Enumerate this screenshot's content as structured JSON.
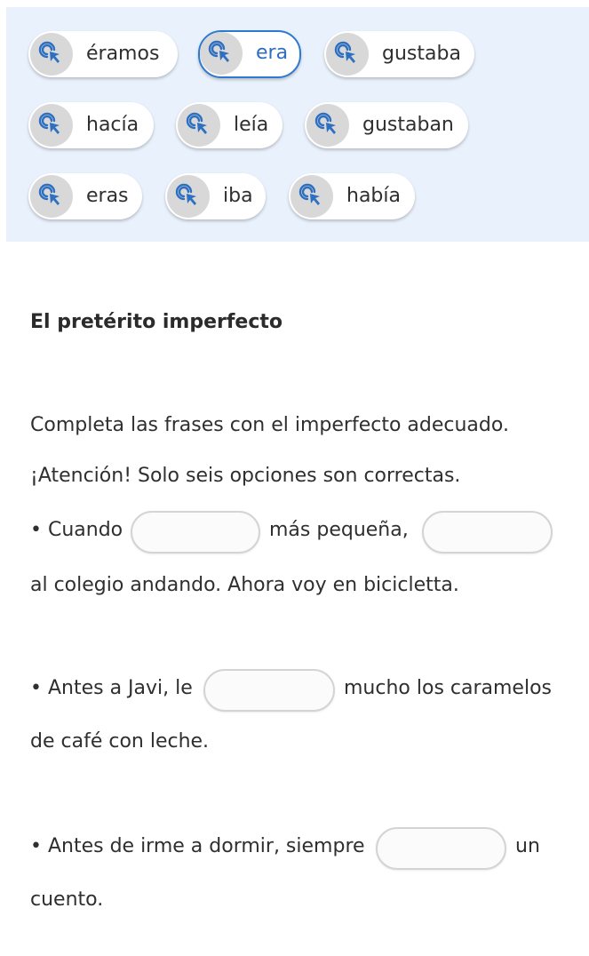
{
  "word_bank": {
    "chips": [
      {
        "label": "éramos",
        "icon": "cursor-target-icon",
        "selected": false
      },
      {
        "label": "era",
        "icon": "cursor-target-icon",
        "selected": true
      },
      {
        "label": "gustaba",
        "icon": "cursor-target-icon",
        "selected": false
      },
      {
        "label": "hacía",
        "icon": "cursor-target-icon",
        "selected": false
      },
      {
        "label": "leía",
        "icon": "cursor-target-icon",
        "selected": false
      },
      {
        "label": "gustaban",
        "icon": "cursor-target-icon",
        "selected": false
      },
      {
        "label": "eras",
        "icon": "cursor-target-icon",
        "selected": false
      },
      {
        "label": "iba",
        "icon": "cursor-target-icon",
        "selected": false
      },
      {
        "label": "había",
        "icon": "cursor-target-icon",
        "selected": false
      }
    ]
  },
  "exercise": {
    "title": "El pretérito imperfecto",
    "instruction": "Completa las frases con el imperfecto adecuado.",
    "warning": "¡Atención! Solo seis opciones son correctas.",
    "s1": {
      "a": "• Cuando",
      "b": "más pequeña,",
      "c": "al colegio andando. Ahora voy en bicicletta."
    },
    "s2": {
      "a": "• Antes a Javi, le",
      "b": "mucho los caramelos",
      "c": "de café con leche."
    },
    "s3": {
      "a": "• Antes de irme a dormir, siempre",
      "b": "un",
      "c": "cuento."
    }
  },
  "colors": {
    "accent": "#2d7ad0",
    "bank_bg": "#e9f1fc",
    "icon_circle": "#d8d8d8"
  }
}
